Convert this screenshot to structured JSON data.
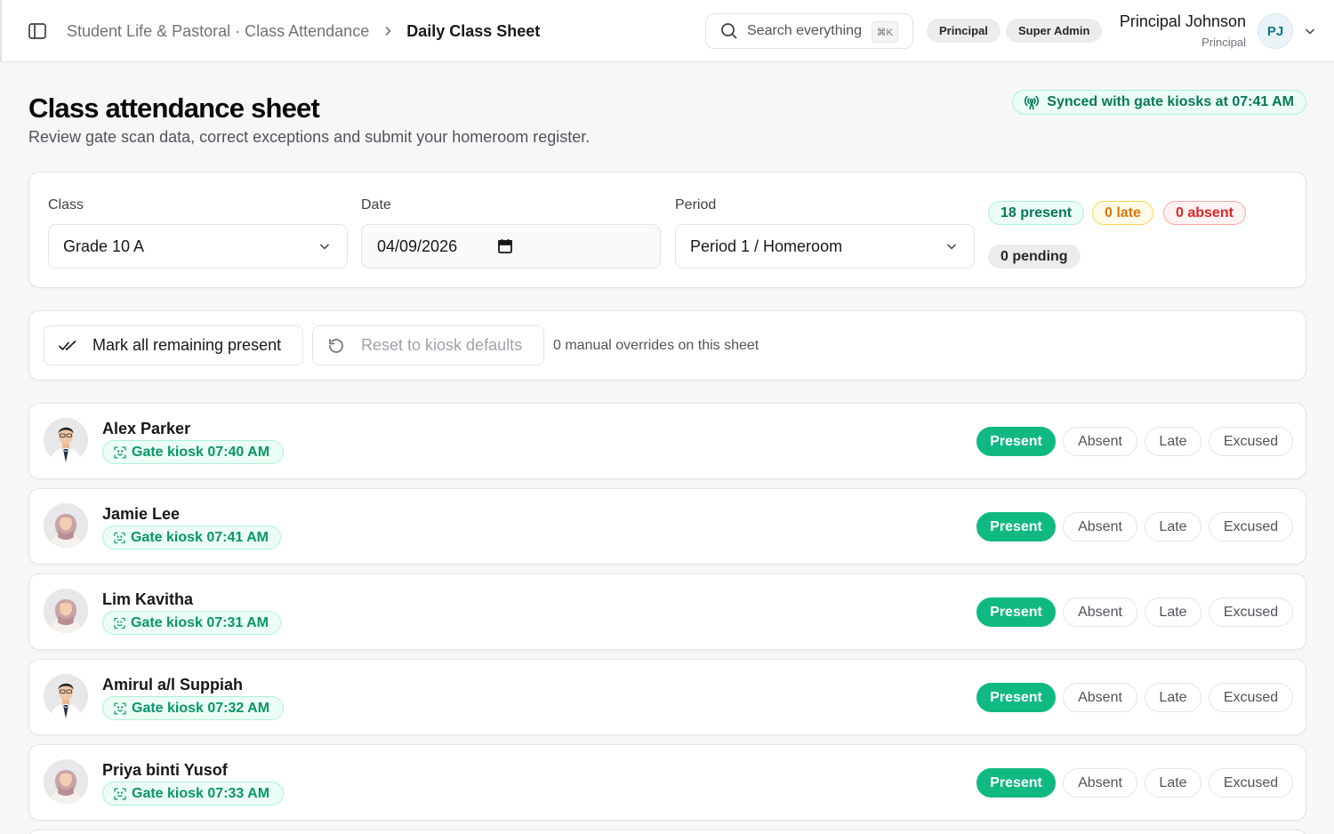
{
  "header": {
    "breadcrumb_parent": "Student Life & Pastoral · Class Attendance",
    "breadcrumb_current": "Daily Class Sheet",
    "search_placeholder": "Search everything",
    "search_shortcut": "⌘K",
    "roles": [
      "Principal",
      "Super Admin"
    ],
    "user_name": "Principal Johnson",
    "user_role": "Principal",
    "user_initials": "PJ"
  },
  "page": {
    "title": "Class attendance sheet",
    "subtitle": "Review gate scan data, correct exceptions and submit your homeroom register.",
    "sync_status": "Synced with gate kiosks at 07:41 AM"
  },
  "filters": {
    "class_label": "Class",
    "class_value": "Grade 10 A",
    "date_label": "Date",
    "date_value": "04/09/2026",
    "period_label": "Period",
    "period_value": "Period 1 / Homeroom"
  },
  "counts": {
    "present": "18 present",
    "late": "0 late",
    "absent": "0 absent",
    "pending": "0 pending"
  },
  "actions": {
    "mark_all": "Mark all remaining present",
    "reset": "Reset to kiosk defaults",
    "overrides": "0 manual overrides on this sheet"
  },
  "status_options": {
    "present": "Present",
    "absent": "Absent",
    "late": "Late",
    "excused": "Excused"
  },
  "students": [
    {
      "name": "Alex Parker",
      "gate": "Gate kiosk 07:40 AM",
      "status": "Present",
      "avatar": "male"
    },
    {
      "name": "Jamie Lee",
      "gate": "Gate kiosk 07:41 AM",
      "status": "Present",
      "avatar": "female"
    },
    {
      "name": "Lim Kavitha",
      "gate": "Gate kiosk 07:31 AM",
      "status": "Present",
      "avatar": "female"
    },
    {
      "name": "Amirul a/l Suppiah",
      "gate": "Gate kiosk 07:32 AM",
      "status": "Present",
      "avatar": "male"
    },
    {
      "name": "Priya binti Yusof",
      "gate": "Gate kiosk 07:33 AM",
      "status": "Present",
      "avatar": "female"
    }
  ],
  "colors": {
    "accent_green": "#10b981",
    "badge_green_text": "#047857",
    "late_amber": "#d97706",
    "absent_red": "#dc2626"
  },
  "icons": {
    "sidebar_toggle": "sidebar-panel-icon",
    "search": "search-icon",
    "breadcrumb_separator": "chevron-right-icon",
    "sync": "broadcast-icon",
    "gate": "face-scan-icon",
    "mark_all": "double-check-icon",
    "reset": "rotate-ccw-icon",
    "date": "calendar-icon",
    "dropdown": "chevron-down-icon"
  }
}
